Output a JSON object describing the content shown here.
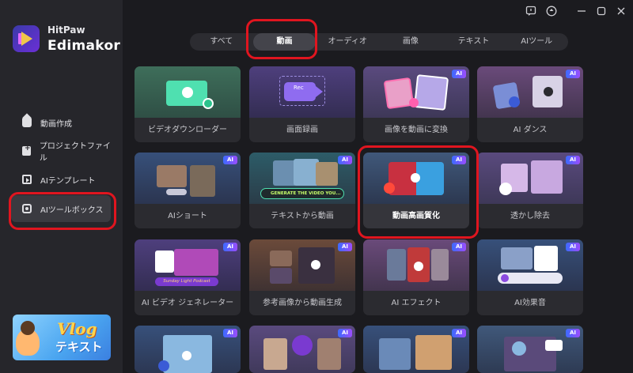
{
  "app": {
    "brand_small": "HitPaw",
    "brand_big": "Edimakor"
  },
  "sidebar": {
    "items": [
      {
        "label": "動画作成"
      },
      {
        "label": "プロジェクトファイル"
      },
      {
        "label": "AIテンプレート"
      },
      {
        "label": "AIツールボックス"
      }
    ],
    "promo": {
      "title": "Vlog",
      "subtitle": "テキスト"
    }
  },
  "tabs": [
    {
      "label": "すべて"
    },
    {
      "label": "動画"
    },
    {
      "label": "オーディオ"
    },
    {
      "label": "画像"
    },
    {
      "label": "テキスト"
    },
    {
      "label": "AIツール"
    }
  ],
  "badge": "AI",
  "cards": [
    {
      "label": "ビデオダウンローダー"
    },
    {
      "label": "画面録画",
      "thumb_text": "Rec"
    },
    {
      "label": "画像を動画に変換"
    },
    {
      "label": "AI ダンス"
    },
    {
      "label": "AIショート"
    },
    {
      "label": "テキストから動画",
      "thumb_text": "GENERATE THE VIDEO YOU..."
    },
    {
      "label": "動画高画質化"
    },
    {
      "label": "透かし除去"
    },
    {
      "label": "AI ビデオ ジェネレーター",
      "thumb_text": "Sunday Light Podcast"
    },
    {
      "label": "参考画像から動画生成"
    },
    {
      "label": "AI エフェクト"
    },
    {
      "label": "AI効果音"
    }
  ],
  "colors": {
    "annotation": "#e0151f",
    "accent": "#6b2fd6"
  }
}
